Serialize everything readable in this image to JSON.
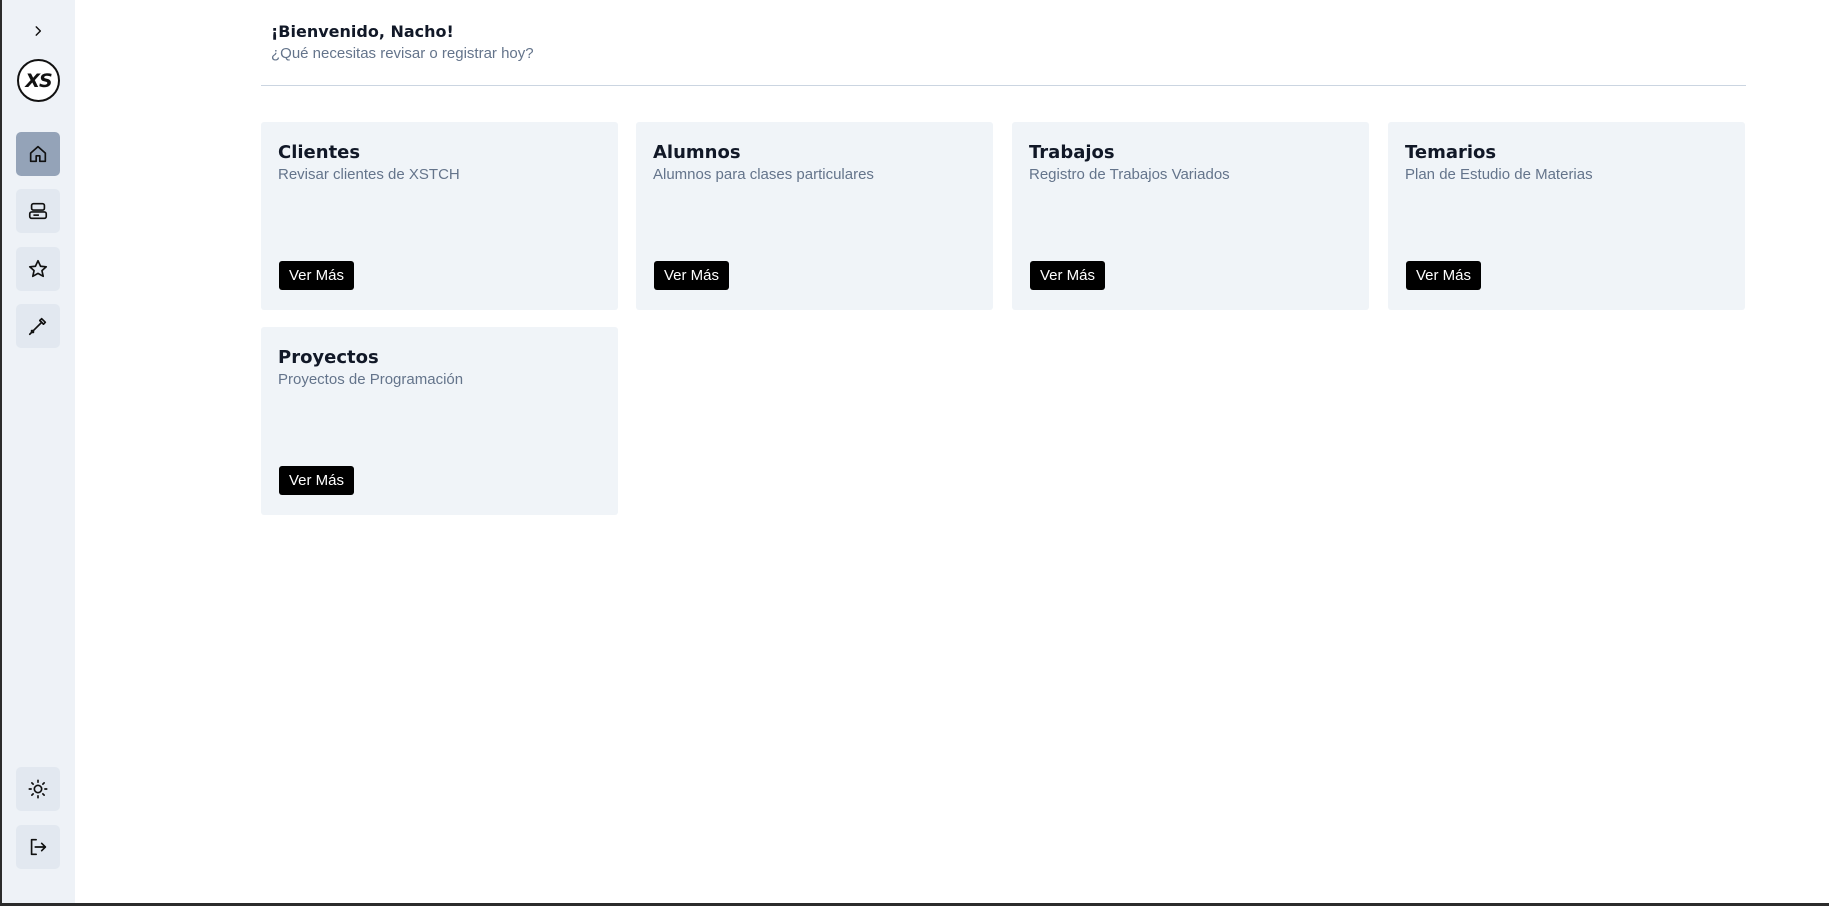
{
  "sidebar": {
    "expand_icon": "chevron-right-icon",
    "logo_text": "XS",
    "nav": [
      {
        "name": "home",
        "icon": "home-icon",
        "active": true
      },
      {
        "name": "server",
        "icon": "server-icon",
        "active": false
      },
      {
        "name": "favorites",
        "icon": "star-icon",
        "active": false
      },
      {
        "name": "tools",
        "icon": "eyedropper-icon",
        "active": false
      }
    ],
    "bottom": [
      {
        "name": "theme",
        "icon": "sun-icon"
      },
      {
        "name": "logout",
        "icon": "logout-icon"
      }
    ]
  },
  "header": {
    "welcome": "¡Bienvenido, Nacho!",
    "subtitle": "¿Qué necesitas revisar o registrar hoy?"
  },
  "cards": [
    {
      "title": "Clientes",
      "description": "Revisar clientes de XSTCH",
      "button": "Ver Más"
    },
    {
      "title": "Alumnos",
      "description": "Alumnos para clases particulares",
      "button": "Ver Más"
    },
    {
      "title": "Trabajos",
      "description": "Registro de Trabajos Variados",
      "button": "Ver Más"
    },
    {
      "title": "Temarios",
      "description": "Plan de Estudio de Materias",
      "button": "Ver Más"
    },
    {
      "title": "Proyectos",
      "description": "Proyectos de Programación",
      "button": "Ver Más"
    }
  ],
  "colors": {
    "sidebar_bg": "#eef2f7",
    "card_bg": "#f0f4f8",
    "active_nav": "#94a3b8",
    "button_bg": "#000000"
  }
}
